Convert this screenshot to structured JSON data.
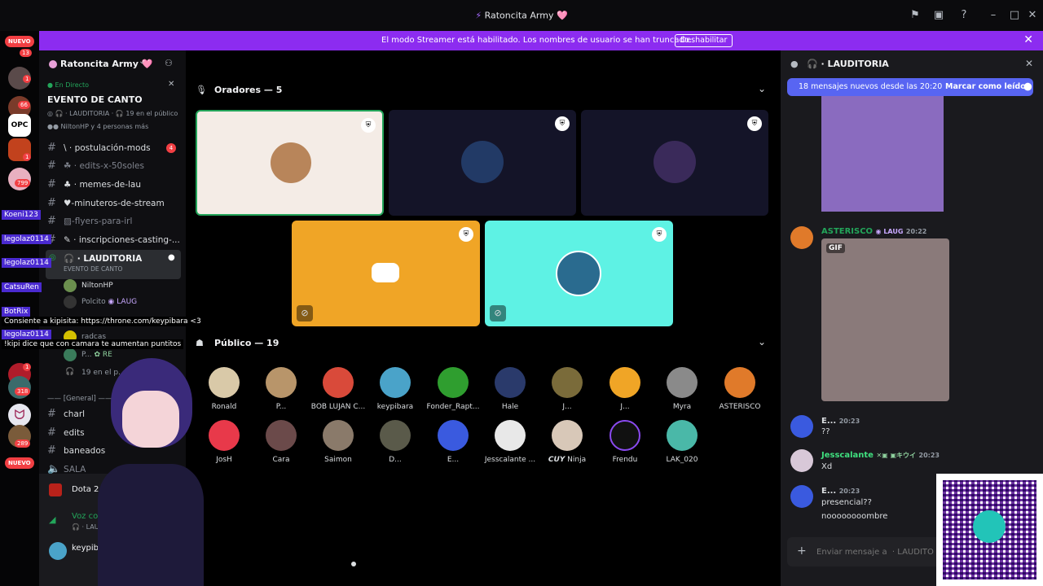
{
  "window": {
    "title": "Ratoncita Army 🩷"
  },
  "banner": {
    "message": "El modo Streamer está habilitado. Los nombres de usuario se han truncado.",
    "button": "Deshabilitar"
  },
  "rail": {
    "nuevo_top": "NUEVO",
    "nuevo_bottom": "NUEVO",
    "badges": [
      "13",
      "1",
      "66",
      "1",
      "799",
      "318",
      "1",
      "289"
    ]
  },
  "server": {
    "name": "Ratoncita Army 🩷"
  },
  "live": {
    "status": "En Directo",
    "event_title": "EVENTO DE CANTO",
    "channel": "LAUDITORIA",
    "public_count": "19 en el público",
    "participants": "NiltonHP y 4 personas más"
  },
  "channels": [
    {
      "name": "postulación-mods",
      "badge": "4"
    },
    {
      "name": "edits-x-50soles"
    },
    {
      "name": "memes-de-lau"
    },
    {
      "name": "-minuteros-de-stream"
    },
    {
      "name": "-flyers-para-irl"
    },
    {
      "name": "inscripciones-casting-..."
    }
  ],
  "voice_channel": {
    "name": "LAUDITORIA",
    "event": "EVENTO DE CANTO",
    "members": [
      "NiltonHP",
      "Polcito",
      "radcas",
      "P...",
      "19 en el p..."
    ],
    "tag": "LAUG",
    "tag2": "RE"
  },
  "category": "General",
  "channels_lower": [
    "charl",
    "edits",
    "baneados",
    "SALA"
  ],
  "activity": {
    "game": "Dota 2",
    "voice_status": "Voz conectada",
    "voice_channel": "LAUDITORIA / ..."
  },
  "user": {
    "name": "keypibara"
  },
  "overlay": {
    "names": [
      "Koeni123",
      "legolaz0114",
      "legolaz0114",
      "CatsuRen",
      "BotRix",
      "legolaz0114"
    ],
    "message1": "Consiente a kipisita: https://throne.com/keypibara <3",
    "message2": "!kipi dice que con camara te aumentan puntitos"
  },
  "speakers": {
    "title": "Oradores — 5"
  },
  "audience": {
    "title": "Público — 19",
    "row1": [
      "Ronald",
      "P...",
      "BOB LUJAN C...",
      "keypibara",
      "Fonder_Rapt...",
      "Hale",
      "J...",
      "J...",
      "Myra",
      "ASTERISCO"
    ],
    "row2": [
      "JosH",
      "Cara",
      "Saimon",
      "D...",
      "E...",
      "Jesscalante ...",
      "Ninja",
      "Frendu",
      "LAK_020"
    ],
    "cuy_tag": "CUY"
  },
  "chat": {
    "channel": "LAUDITORIA",
    "new_messages": "18 mensajes nuevos desde las 20:20",
    "mark_read": "Marcar como leído",
    "messages": [
      {
        "author": "ASTERISCO",
        "tag": "LAUG",
        "time": "20:22",
        "text": "",
        "gif": "GIF"
      },
      {
        "author": "E...",
        "time": "20:23",
        "text": "??"
      },
      {
        "author": "Jesscalante",
        "tag": "キウイ",
        "time": "20:23",
        "text": "Xd"
      },
      {
        "author": "E...",
        "time": "20:23",
        "text": "presencial??",
        "text2": "noooooooombre"
      }
    ],
    "input_placeholder": "Enviar mensaje a  · LAUDITO"
  },
  "colors": {
    "banner": "#8c2cf0",
    "accent": "#5865f2",
    "green": "#23a55a",
    "speaker_yellow": "#f0a526",
    "speaker_cyan": "#5ef2e4"
  }
}
